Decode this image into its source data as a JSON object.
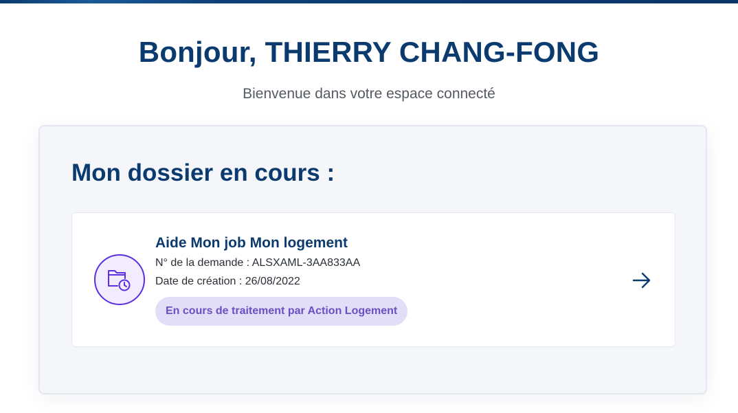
{
  "header": {
    "greeting_prefix": "Bonjour,",
    "user_name": "THIERRY CHANG-FONG",
    "subtitle": "Bienvenue dans votre espace connecté"
  },
  "dossier": {
    "section_title": "Mon dossier en cours :",
    "card": {
      "title": "Aide Mon job Mon logement",
      "request_number": "N° de la demande : ALSXAML-3AA833AA",
      "creation_date": "Date de création : 26/08/2022",
      "status": "En cours de traitement par Action Logement",
      "icon": "folder-clock-icon",
      "action_icon": "arrow-right-icon"
    }
  },
  "colors": {
    "primary": "#0b3b6e",
    "accent_purple": "#5b2ee0",
    "status_bg": "#e3def7",
    "status_text": "#6b4fc3"
  }
}
